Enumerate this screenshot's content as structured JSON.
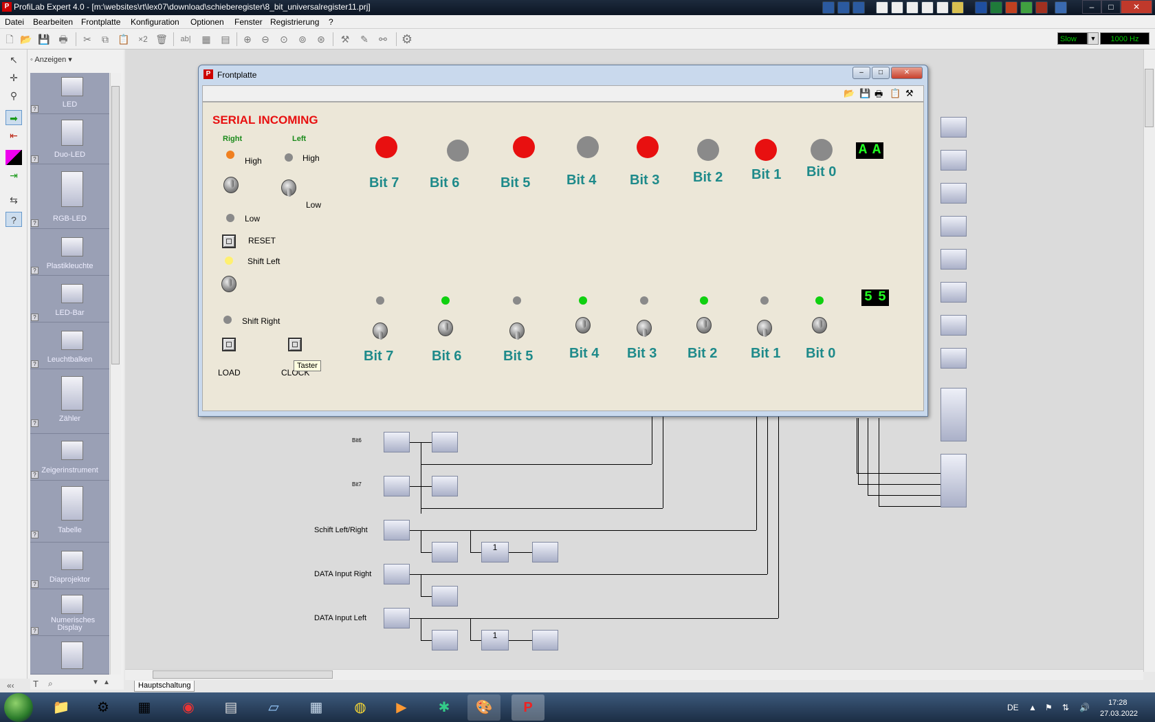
{
  "window": {
    "title": "ProfiLab Expert 4.0 - [m:\\websites\\rt\\lex07\\download\\schieberegister\\8_bit_universalregister11.prj]",
    "min": "–",
    "max": "□",
    "close": "✕"
  },
  "menu": [
    "Datei",
    "Bearbeiten",
    "Frontplatte",
    "Konfiguration",
    "Optionen",
    "Fenster",
    "Registrierung",
    "?"
  ],
  "toolbar": {
    "speed": "Slow",
    "frequency": "1000 Hz"
  },
  "library": {
    "header": "Anzeigen",
    "items": [
      "LED",
      "Duo-LED",
      "RGB-LED",
      "Plastikleuchte",
      "LED-Bar",
      "Leuchtbalken",
      "Zähler",
      "Zeigerinstrument",
      "Tabelle",
      "Diaprojektor",
      "Numerisches Display"
    ]
  },
  "sheet_tab": "Hauptschaltung",
  "circuit_labels": [
    "Bit6",
    "Bit7",
    "Schift Left/Right",
    "DATA Input Right",
    "DATA Input Left"
  ],
  "frontplate": {
    "title": "Frontplatte",
    "heading": "SERIAL INCOMING",
    "right": "Right",
    "left": "Left",
    "high1": "High",
    "high2": "High",
    "low1": "Low",
    "low2": "Low",
    "reset": "RESET",
    "shift_left": "Shift Left",
    "shift_right": "Shift Right",
    "load": "LOAD",
    "clock": "CLOCK",
    "tooltip": "Taster",
    "top_bits": [
      {
        "label": "Bit 7",
        "state": "on"
      },
      {
        "label": "Bit 6",
        "state": "off"
      },
      {
        "label": "Bit 5",
        "state": "on"
      },
      {
        "label": "Bit 4",
        "state": "off"
      },
      {
        "label": "Bit 3",
        "state": "on"
      },
      {
        "label": "Bit 2",
        "state": "off"
      },
      {
        "label": "Bit 1",
        "state": "on"
      },
      {
        "label": "Bit 0",
        "state": "off"
      }
    ],
    "bottom_bits": [
      {
        "label": "Bit 7",
        "state": "off"
      },
      {
        "label": "Bit 6",
        "state": "on"
      },
      {
        "label": "Bit 5",
        "state": "off"
      },
      {
        "label": "Bit 4",
        "state": "on"
      },
      {
        "label": "Bit 3",
        "state": "off"
      },
      {
        "label": "Bit 2",
        "state": "on"
      },
      {
        "label": "Bit 1",
        "state": "off"
      },
      {
        "label": "Bit 0",
        "state": "on"
      }
    ],
    "hex_top": [
      "A",
      "A"
    ],
    "hex_bottom": [
      "5",
      "5"
    ]
  },
  "taskbar": {
    "lang": "DE",
    "time": "17:28",
    "date": "27.03.2022"
  },
  "colors": {
    "led_on_red": "#e81010",
    "led_off": "#8a8a8a",
    "led_on_green": "#10d010",
    "bit_label": "#1e8a8a",
    "heading": "#e81010"
  }
}
